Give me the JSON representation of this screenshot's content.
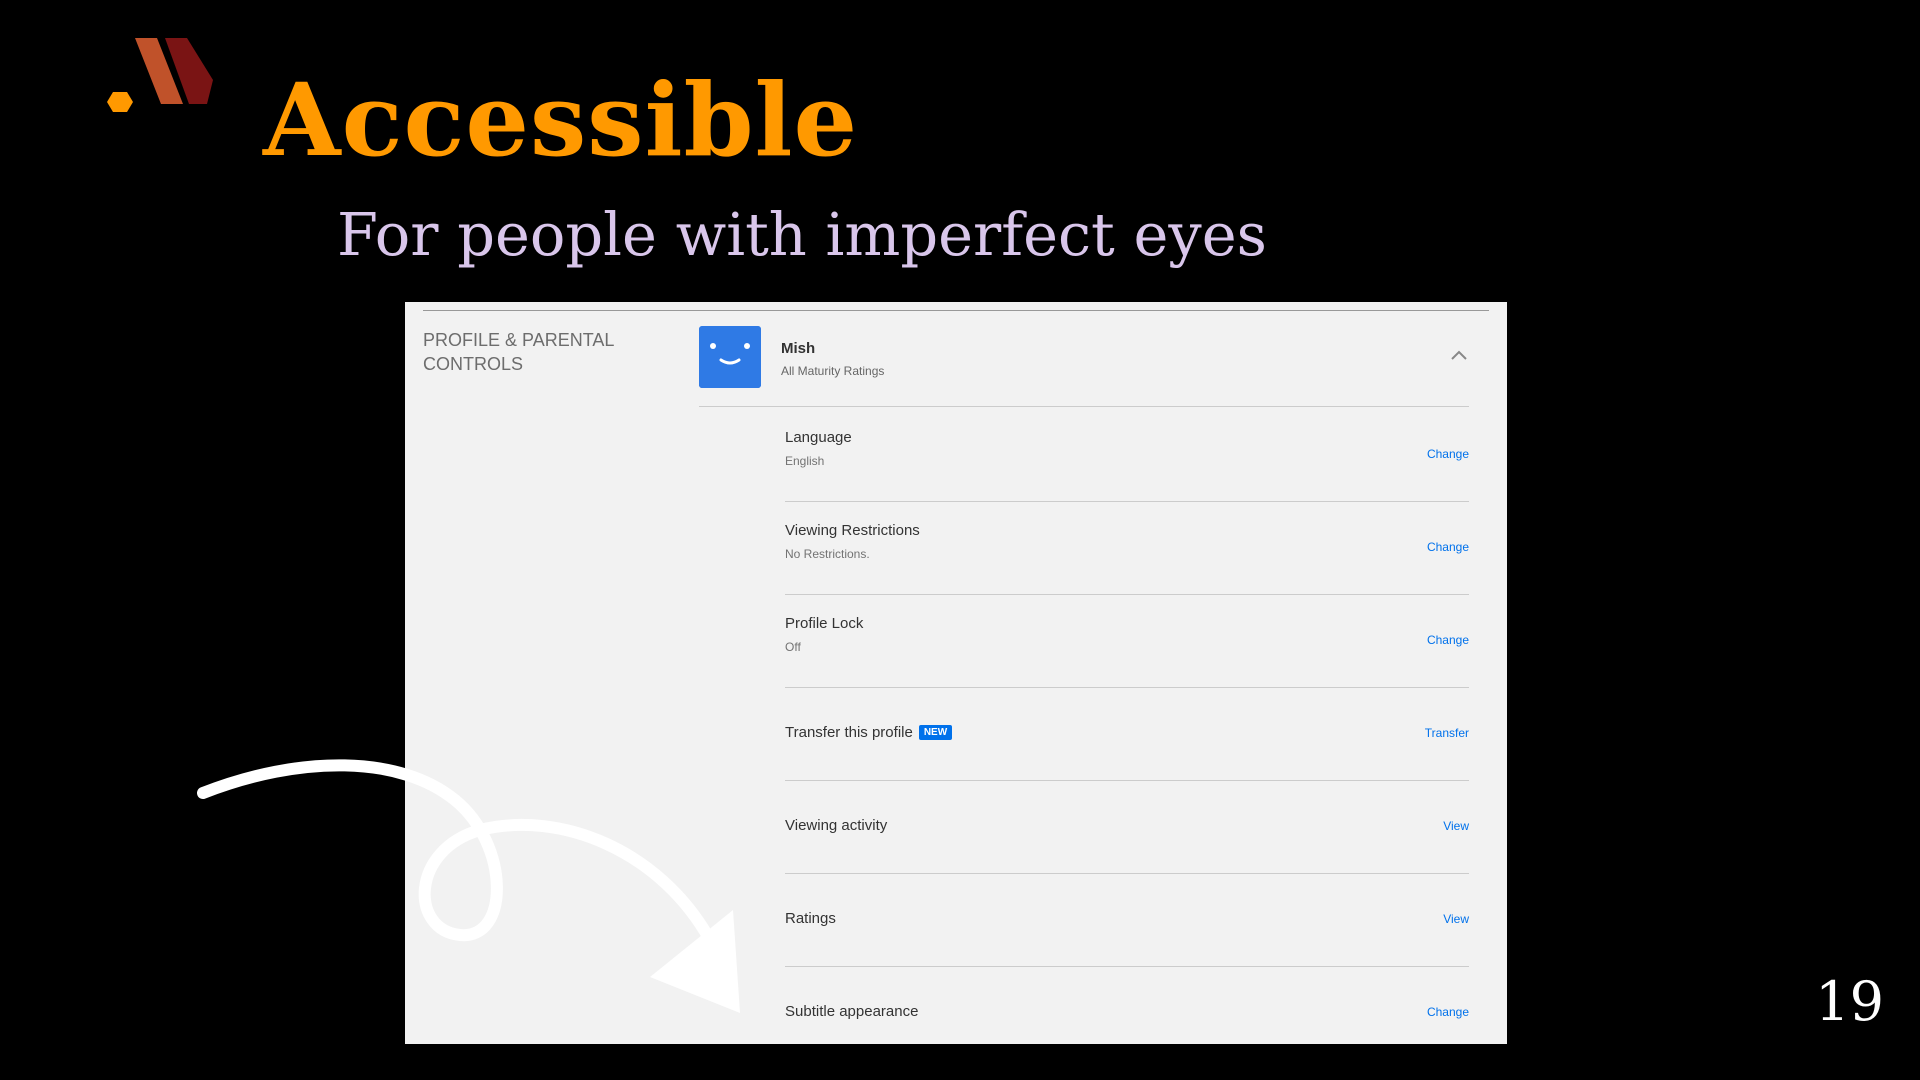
{
  "slide": {
    "title": "Accessible",
    "subtitle": "For people with imperfect eyes",
    "page_number": "19",
    "colors": {
      "title": "#FF9900",
      "subtitle": "#D9C6EB",
      "background": "#000000"
    }
  },
  "logo": {
    "icon": "hexagon-m-logo-icon"
  },
  "settings": {
    "section_heading": "PROFILE & PARENTAL CONTROLS",
    "profile": {
      "name": "Mish",
      "maturity": "All Maturity Ratings",
      "avatar_icon": "smiley-face-icon",
      "toggle_icon": "chevron-up-icon"
    },
    "rows": [
      {
        "label": "Language",
        "value": "English",
        "action": "Change"
      },
      {
        "label": "Viewing Restrictions",
        "value": "No Restrictions.",
        "action": "Change"
      },
      {
        "label": "Profile Lock",
        "value": "Off",
        "action": "Change"
      },
      {
        "label": "Transfer this profile",
        "badge": "NEW",
        "action": "Transfer"
      },
      {
        "label": "Viewing activity",
        "action": "View"
      },
      {
        "label": "Ratings",
        "action": "View"
      },
      {
        "label": "Subtitle appearance",
        "action": "Change"
      }
    ],
    "colors": {
      "link": "#0071EB",
      "panel": "#F2F2F2",
      "avatar": "#2F7AE5"
    }
  },
  "annotation": {
    "icon": "curved-arrow-icon",
    "color": "#FFFFFF"
  }
}
